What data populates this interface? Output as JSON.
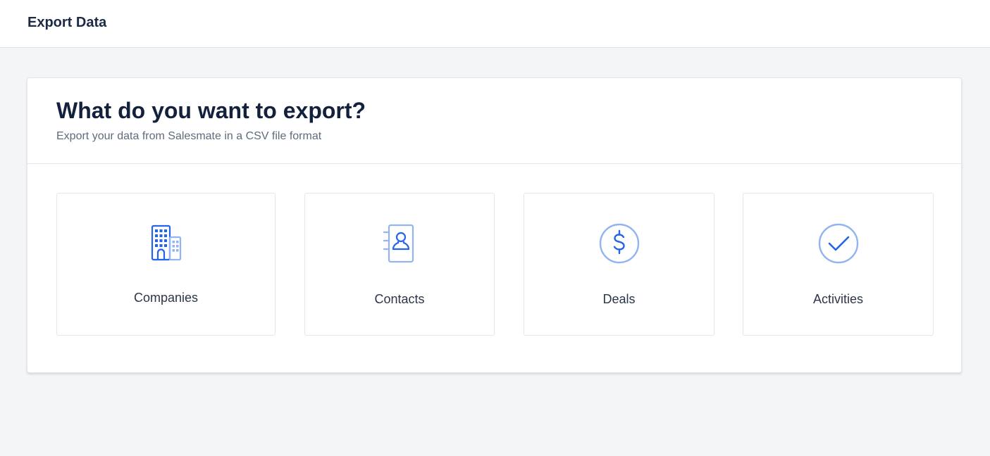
{
  "header": {
    "title": "Export Data"
  },
  "card": {
    "heading": "What do you want to export?",
    "subtitle": "Export your data from Salesmate in a CSV file format"
  },
  "options": [
    {
      "label": "Companies",
      "icon": "building-icon"
    },
    {
      "label": "Contacts",
      "icon": "contact-book-icon"
    },
    {
      "label": "Deals",
      "icon": "dollar-circle-icon"
    },
    {
      "label": "Activities",
      "icon": "check-circle-icon"
    }
  ],
  "colors": {
    "accent": "#2563eb",
    "accent_light": "#93b4f0",
    "text_dark": "#14213d",
    "text_muted": "#5f6b7d",
    "background": "#f4f5f7"
  }
}
